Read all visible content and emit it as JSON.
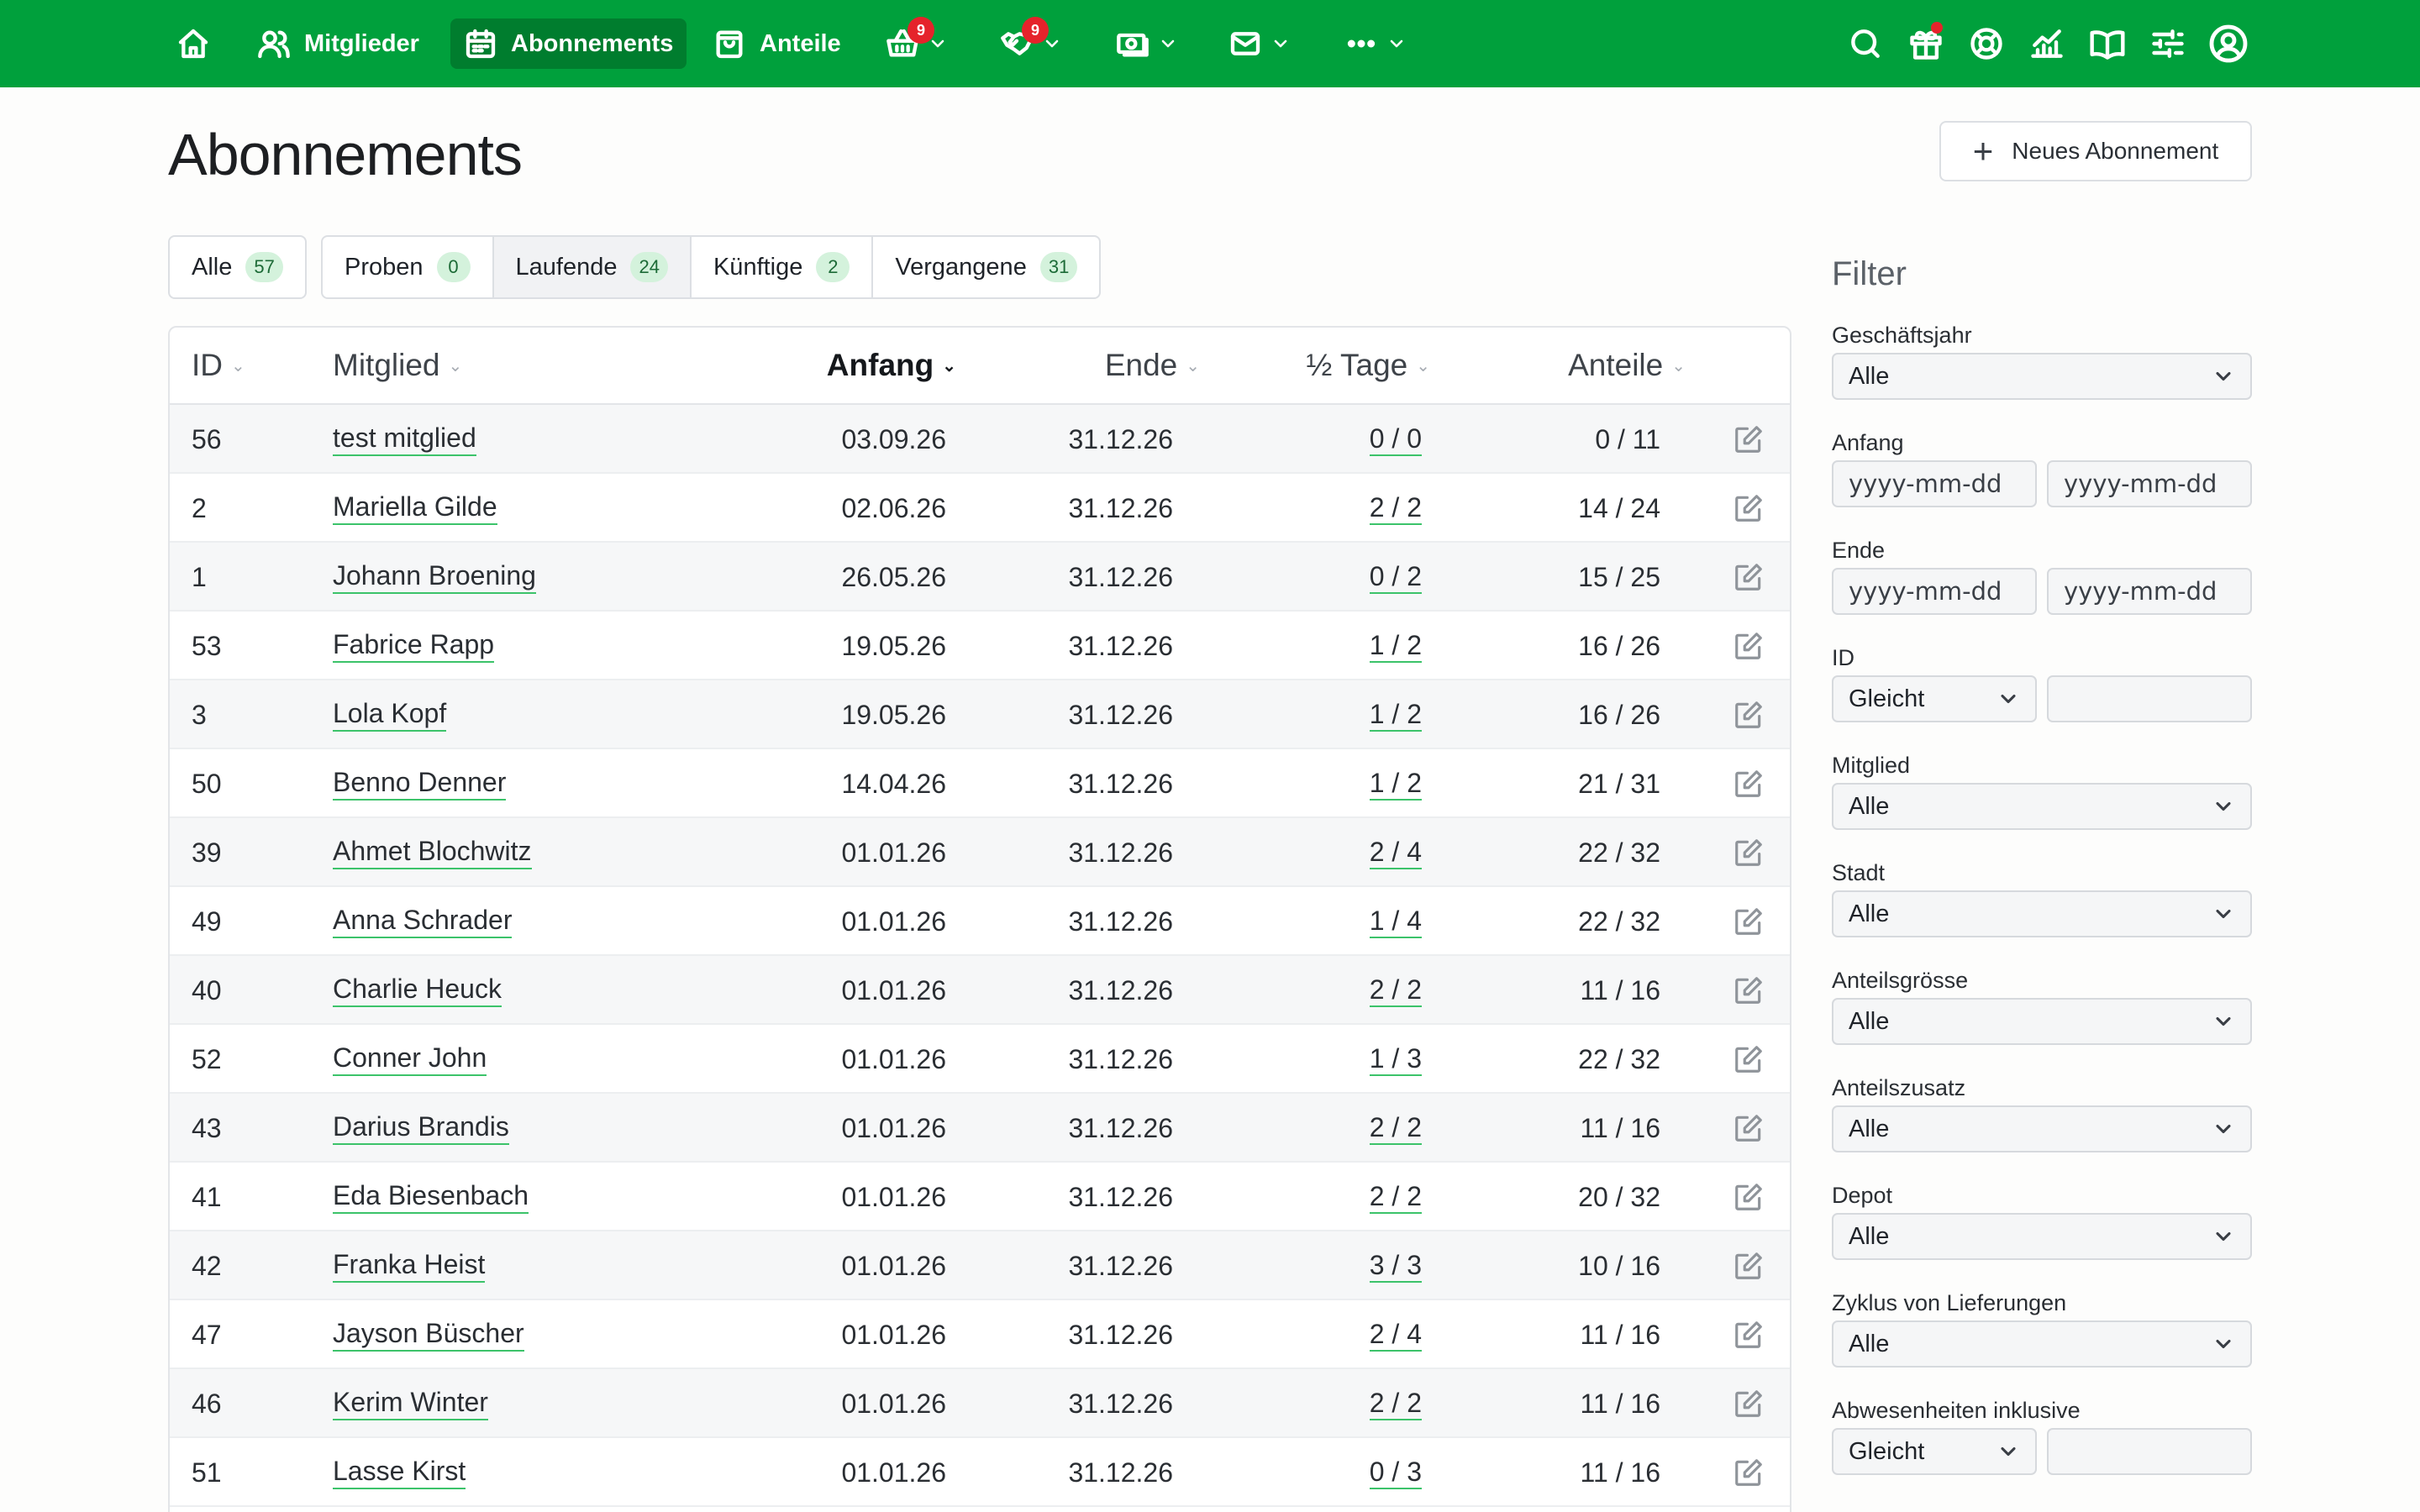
{
  "nav": {
    "members_label": "Mitglieder",
    "subscriptions_label": "Abonnements",
    "shares_label": "Anteile",
    "basket_badge": "9",
    "handshake_badge": "9"
  },
  "page": {
    "title": "Abonnements",
    "new_button_label": "Neues Abonnement"
  },
  "tabs": [
    {
      "label": "Alle",
      "count": "57"
    },
    {
      "label": "Proben",
      "count": "0"
    },
    {
      "label": "Laufende",
      "count": "24"
    },
    {
      "label": "Künftige",
      "count": "2"
    },
    {
      "label": "Vergangene",
      "count": "31"
    }
  ],
  "table": {
    "headers": {
      "id": "ID",
      "member": "Mitglied",
      "start": "Anfang",
      "end": "Ende",
      "days": "½ Tage",
      "shares": "Anteile"
    },
    "rows": [
      {
        "id": "56",
        "member": "test mitglied",
        "start": "03.09.26",
        "end": "31.12.26",
        "days": "0 / 0",
        "shares": "0 / 11"
      },
      {
        "id": "2",
        "member": "Mariella Gilde",
        "start": "02.06.26",
        "end": "31.12.26",
        "days": "2 / 2",
        "shares": "14 / 24"
      },
      {
        "id": "1",
        "member": "Johann Broening",
        "start": "26.05.26",
        "end": "31.12.26",
        "days": "0 / 2",
        "shares": "15 / 25"
      },
      {
        "id": "53",
        "member": "Fabrice Rapp",
        "start": "19.05.26",
        "end": "31.12.26",
        "days": "1 / 2",
        "shares": "16 / 26"
      },
      {
        "id": "3",
        "member": "Lola Kopf",
        "start": "19.05.26",
        "end": "31.12.26",
        "days": "1 / 2",
        "shares": "16 / 26"
      },
      {
        "id": "50",
        "member": "Benno Denner",
        "start": "14.04.26",
        "end": "31.12.26",
        "days": "1 / 2",
        "shares": "21 / 31"
      },
      {
        "id": "39",
        "member": "Ahmet Blochwitz",
        "start": "01.01.26",
        "end": "31.12.26",
        "days": "2 / 4",
        "shares": "22 / 32"
      },
      {
        "id": "49",
        "member": "Anna Schrader",
        "start": "01.01.26",
        "end": "31.12.26",
        "days": "1 / 4",
        "shares": "22 / 32"
      },
      {
        "id": "40",
        "member": "Charlie Heuck",
        "start": "01.01.26",
        "end": "31.12.26",
        "days": "2 / 2",
        "shares": "11 / 16"
      },
      {
        "id": "52",
        "member": "Conner John",
        "start": "01.01.26",
        "end": "31.12.26",
        "days": "1 / 3",
        "shares": "22 / 32"
      },
      {
        "id": "43",
        "member": "Darius Brandis",
        "start": "01.01.26",
        "end": "31.12.26",
        "days": "2 / 2",
        "shares": "11 / 16"
      },
      {
        "id": "41",
        "member": "Eda Biesenbach",
        "start": "01.01.26",
        "end": "31.12.26",
        "days": "2 / 2",
        "shares": "20 / 32"
      },
      {
        "id": "42",
        "member": "Franka Heist",
        "start": "01.01.26",
        "end": "31.12.26",
        "days": "3 / 3",
        "shares": "10 / 16"
      },
      {
        "id": "47",
        "member": "Jayson Büscher",
        "start": "01.01.26",
        "end": "31.12.26",
        "days": "2 / 4",
        "shares": "11 / 16"
      },
      {
        "id": "46",
        "member": "Kerim Winter",
        "start": "01.01.26",
        "end": "31.12.26",
        "days": "2 / 2",
        "shares": "11 / 16"
      },
      {
        "id": "51",
        "member": "Lasse Kirst",
        "start": "01.01.26",
        "end": "31.12.26",
        "days": "0 / 3",
        "shares": "11 / 16"
      }
    ]
  },
  "filter": {
    "title": "Filter",
    "fiscal_year_label": "Geschäftsjahr",
    "fiscal_year_value": "Alle",
    "start_label": "Anfang",
    "end_label": "Ende",
    "date_placeholder": "yyyy-mm-dd",
    "id_label": "ID",
    "id_operator": "Gleicht",
    "member_label": "Mitglied",
    "member_value": "Alle",
    "city_label": "Stadt",
    "city_value": "Alle",
    "share_size_label": "Anteilsgrösse",
    "share_size_value": "Alle",
    "share_extra_label": "Anteilszusatz",
    "share_extra_value": "Alle",
    "depot_label": "Depot",
    "depot_value": "Alle",
    "cycle_label": "Zyklus von Lieferungen",
    "cycle_value": "Alle",
    "absences_label": "Abwesenheiten inklusive",
    "absences_operator": "Gleicht"
  },
  "colors": {
    "brand": "#00a03c",
    "badge": "#e5232b",
    "link_underline": "#3cc36a"
  }
}
